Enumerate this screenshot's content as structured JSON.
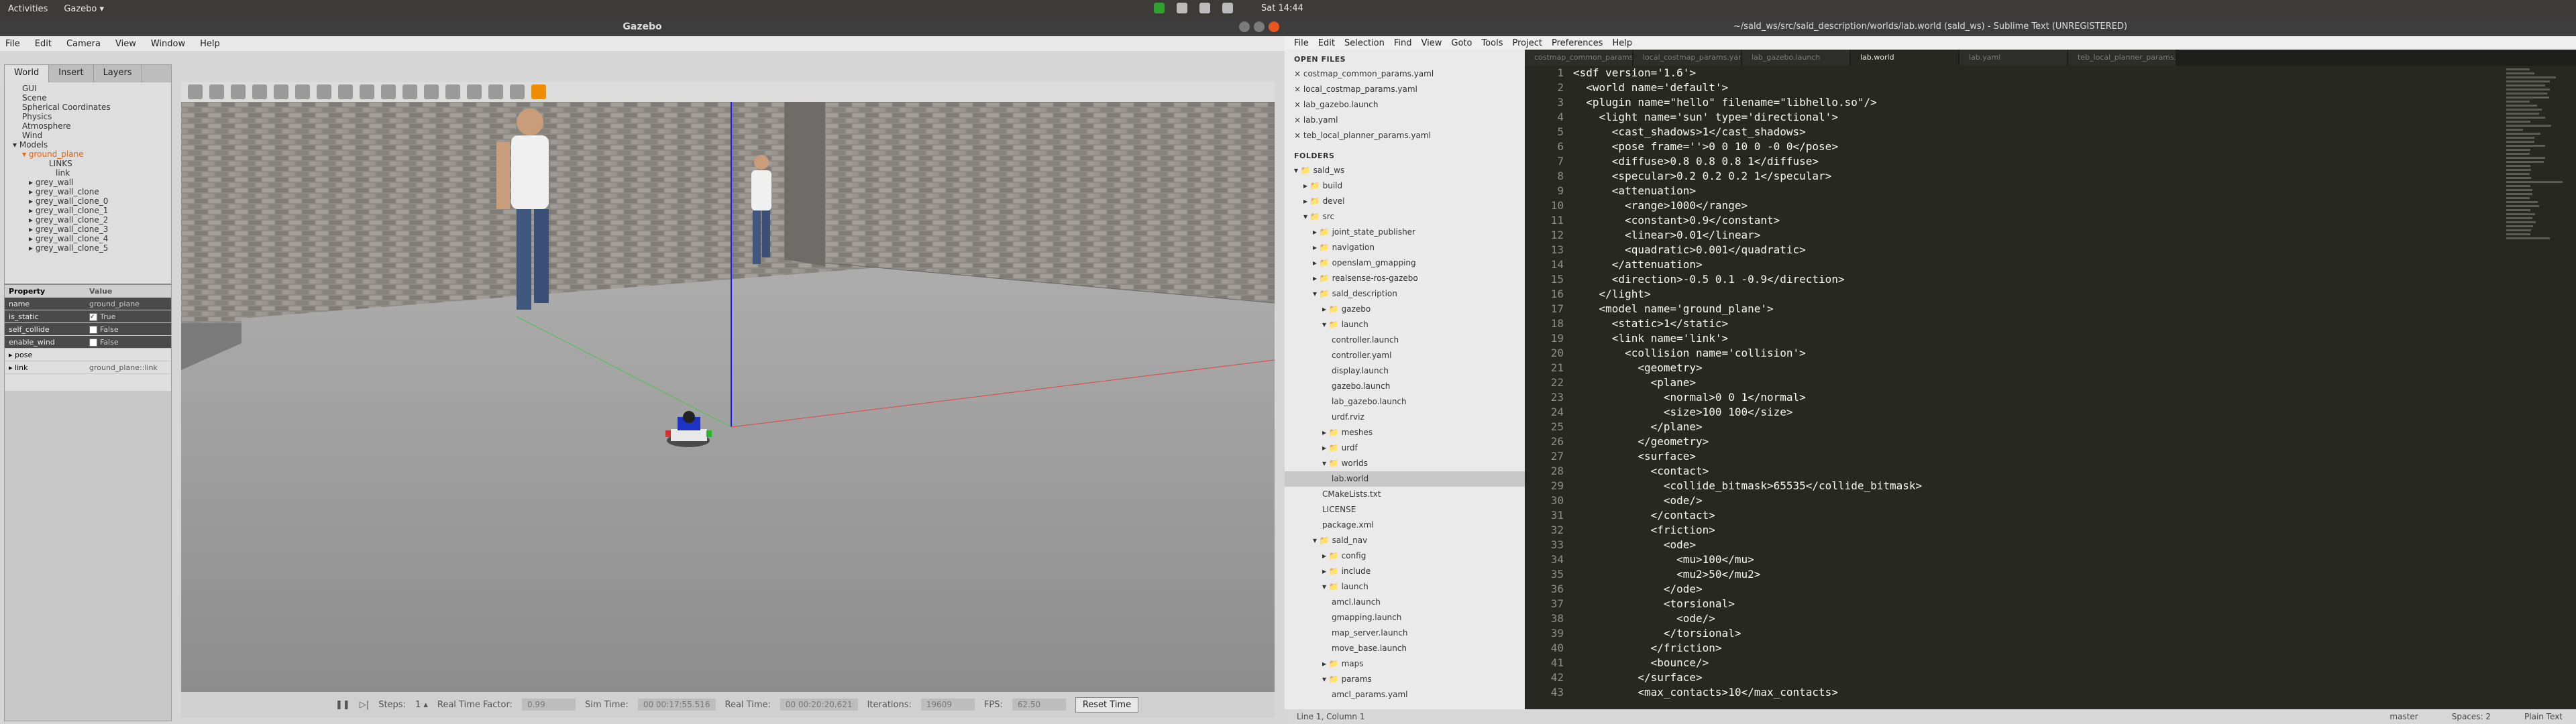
{
  "topbar": {
    "activities": "Activities",
    "app": "Gazebo ▾",
    "clock": "Sat 14:44"
  },
  "gazebo": {
    "title": "Gazebo",
    "menu": [
      "File",
      "Edit",
      "Camera",
      "View",
      "Window",
      "Help"
    ],
    "tabs": [
      "World",
      "Insert",
      "Layers"
    ],
    "tree": [
      "GUI",
      "Scene",
      "Spherical Coordinates",
      "Physics",
      "Atmosphere",
      "Wind",
      "▾ Models",
      "▾ ground_plane",
      "LINKS",
      "link",
      "▸ grey_wall",
      "▸ grey_wall_clone",
      "▸ grey_wall_clone_0",
      "▸ grey_wall_clone_1",
      "▸ grey_wall_clone_2",
      "▸ grey_wall_clone_3",
      "▸ grey_wall_clone_4",
      "▸ grey_wall_clone_5"
    ],
    "props": {
      "head": [
        "Property",
        "Value"
      ],
      "rows": [
        {
          "k": "name",
          "v": "ground_plane"
        },
        {
          "k": "is_static",
          "v": "True"
        },
        {
          "k": "self_collide",
          "v": "False"
        },
        {
          "k": "enable_wind",
          "v": "False"
        },
        {
          "k": "▸ pose",
          "v": ""
        },
        {
          "k": "▸ link",
          "v": "ground_plane::link"
        }
      ]
    },
    "status": {
      "steps_label": "Steps:",
      "steps_value": "1 ▴",
      "rtf_label": "Real Time Factor:",
      "rtf_value": "0.99",
      "sim_label": "Sim Time:",
      "sim_value": "00 00:17:55.516",
      "real_label": "Real Time:",
      "real_value": "00 00:20:20.621",
      "iter_label": "Iterations:",
      "iter_value": "19609",
      "fps_label": "FPS:",
      "fps_value": "62.50",
      "reset": "Reset Time"
    }
  },
  "sublime": {
    "title": "~/sald_ws/src/sald_description/worlds/lab.world (sald_ws) - Sublime Text (UNREGISTERED)",
    "menu": [
      "File",
      "Edit",
      "Selection",
      "Find",
      "View",
      "Goto",
      "Tools",
      "Project",
      "Preferences",
      "Help"
    ],
    "open_files_header": "OPEN FILES",
    "open_files": [
      "× costmap_common_params.yaml",
      "× local_costmap_params.yaml",
      "× lab_gazebo.launch",
      "× lab.yaml",
      "× teb_local_planner_params.yaml"
    ],
    "folders_header": "FOLDERS",
    "folders": [
      {
        "t": "▾ 📁 sald_ws",
        "d": 1
      },
      {
        "t": "▸ 📁 build",
        "d": 2
      },
      {
        "t": "▸ 📁 devel",
        "d": 2
      },
      {
        "t": "▾ 📁 src",
        "d": 2
      },
      {
        "t": "▸ 📁 joint_state_publisher",
        "d": 3
      },
      {
        "t": "▸ 📁 navigation",
        "d": 3
      },
      {
        "t": "▸ 📁 openslam_gmapping",
        "d": 3
      },
      {
        "t": "▸ 📁 realsense-ros-gazebo",
        "d": 3
      },
      {
        "t": "▾ 📁 sald_description",
        "d": 3
      },
      {
        "t": "▸ 📁 gazebo",
        "d": 4
      },
      {
        "t": "▾ 📁 launch",
        "d": 4
      },
      {
        "t": "controller.launch",
        "d": 5
      },
      {
        "t": "controller.yaml",
        "d": 5
      },
      {
        "t": "display.launch",
        "d": 5
      },
      {
        "t": "gazebo.launch",
        "d": 5
      },
      {
        "t": "lab_gazebo.launch",
        "d": 5
      },
      {
        "t": "urdf.rviz",
        "d": 5
      },
      {
        "t": "▸ 📁 meshes",
        "d": 4
      },
      {
        "t": "▸ 📁 urdf",
        "d": 4
      },
      {
        "t": "▾ 📁 worlds",
        "d": 4
      },
      {
        "t": "lab.world",
        "d": 5
      },
      {
        "t": "CMakeLists.txt",
        "d": 4
      },
      {
        "t": "LICENSE",
        "d": 4
      },
      {
        "t": "package.xml",
        "d": 4
      },
      {
        "t": "▾ 📁 sald_nav",
        "d": 3
      },
      {
        "t": "▸ 📁 config",
        "d": 4
      },
      {
        "t": "▸ 📁 include",
        "d": 4
      },
      {
        "t": "▾ 📁 launch",
        "d": 4
      },
      {
        "t": "amcl.launch",
        "d": 5
      },
      {
        "t": "gmapping.launch",
        "d": 5
      },
      {
        "t": "map_server.launch",
        "d": 5
      },
      {
        "t": "move_base.launch",
        "d": 5
      },
      {
        "t": "▸ 📁 maps",
        "d": 4
      },
      {
        "t": "▾ 📁 params",
        "d": 4
      },
      {
        "t": "amcl_params.yaml",
        "d": 5
      }
    ],
    "tabs": [
      "costmap_common_params.yaml",
      "local_costmap_params.yaml",
      "lab_gazebo.launch",
      "lab.world",
      "lab.yaml",
      "teb_local_planner_params.yaml"
    ],
    "active_tab": 3,
    "code": [
      "<sdf version='1.6'>",
      "  <world name='default'>",
      "  <plugin name=\"hello\" filename=\"libhello.so\"/>",
      "    <light name='sun' type='directional'>",
      "      <cast_shadows>1</cast_shadows>",
      "      <pose frame=''>0 0 10 0 -0 0</pose>",
      "      <diffuse>0.8 0.8 0.8 1</diffuse>",
      "      <specular>0.2 0.2 0.2 1</specular>",
      "      <attenuation>",
      "        <range>1000</range>",
      "        <constant>0.9</constant>",
      "        <linear>0.01</linear>",
      "        <quadratic>0.001</quadratic>",
      "      </attenuation>",
      "      <direction>-0.5 0.1 -0.9</direction>",
      "    </light>",
      "    <model name='ground_plane'>",
      "      <static>1</static>",
      "      <link name='link'>",
      "        <collision name='collision'>",
      "          <geometry>",
      "            <plane>",
      "              <normal>0 0 1</normal>",
      "              <size>100 100</size>",
      "            </plane>",
      "          </geometry>",
      "          <surface>",
      "            <contact>",
      "              <collide_bitmask>65535</collide_bitmask>",
      "              <ode/>",
      "            </contact>",
      "            <friction>",
      "              <ode>",
      "                <mu>100</mu>",
      "                <mu2>50</mu2>",
      "              </ode>",
      "              <torsional>",
      "                <ode/>",
      "              </torsional>",
      "            </friction>",
      "            <bounce/>",
      "          </surface>",
      "          <max_contacts>10</max_contacts>"
    ],
    "status": {
      "pos": "Line 1, Column 1",
      "branch": "master",
      "spaces": "Spaces: 2",
      "syntax": "Plain Text"
    }
  }
}
